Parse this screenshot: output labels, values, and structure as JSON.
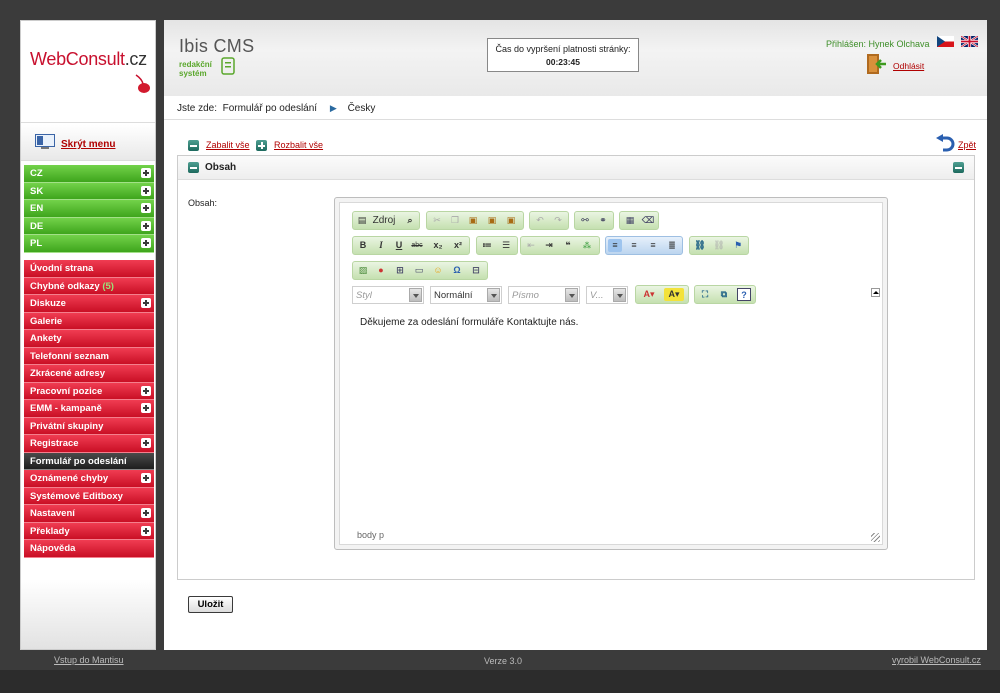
{
  "logo": {
    "text_red": "WebConsult",
    "text_dark": ".cz"
  },
  "sidebar": {
    "hide_menu_label": "Skrýt menu",
    "languages": [
      {
        "label": "CZ",
        "expandable": true
      },
      {
        "label": "SK",
        "expandable": true
      },
      {
        "label": "EN",
        "expandable": true
      },
      {
        "label": "DE",
        "expandable": true
      },
      {
        "label": "PL",
        "expandable": true
      }
    ],
    "items": [
      {
        "label": "Úvodní strana",
        "count": "",
        "expandable": false,
        "active": false
      },
      {
        "label": "Chybné odkazy",
        "count": "(5)",
        "expandable": false,
        "active": false
      },
      {
        "label": "Diskuze",
        "count": "",
        "expandable": true,
        "active": false
      },
      {
        "label": "Galerie",
        "count": "",
        "expandable": false,
        "active": false
      },
      {
        "label": "Ankety",
        "count": "",
        "expandable": false,
        "active": false
      },
      {
        "label": "Telefonní seznam",
        "count": "",
        "expandable": false,
        "active": false
      },
      {
        "label": "Zkrácené adresy",
        "count": "",
        "expandable": false,
        "active": false
      },
      {
        "label": "Pracovní pozice",
        "count": "",
        "expandable": true,
        "active": false
      },
      {
        "label": "EMM - kampaně",
        "count": "",
        "expandable": true,
        "active": false
      },
      {
        "label": "Privátní skupiny",
        "count": "",
        "expandable": false,
        "active": false
      },
      {
        "label": "Registrace",
        "count": "",
        "expandable": true,
        "active": false
      },
      {
        "label": "Formulář po odeslání",
        "count": "",
        "expandable": false,
        "active": true
      },
      {
        "label": "Oznámené chyby",
        "count": "",
        "expandable": true,
        "active": false
      },
      {
        "label": "Systémové Editboxy",
        "count": "",
        "expandable": false,
        "active": false
      },
      {
        "label": "Nastavení",
        "count": "",
        "expandable": true,
        "active": false
      },
      {
        "label": "Překlady",
        "count": "",
        "expandable": true,
        "active": false
      },
      {
        "label": "Nápověda",
        "count": "",
        "expandable": false,
        "active": false
      }
    ]
  },
  "header": {
    "cms_title": "Ibis CMS",
    "cms_sub_1": "redakční",
    "cms_sub_2": "systém",
    "timer_label": "Čas do vypršení platnosti stránky:",
    "timer_value": "00:23:45",
    "user_label": "Přihlášen: Hynek Olchava",
    "logout": "Odhlásit"
  },
  "breadcrumb": {
    "prefix": "Jste zde:",
    "page": "Formulář po odeslání",
    "lang": "Česky"
  },
  "actions": {
    "collapse_all": "Zabalit vše",
    "expand_all": "Rozbalit vše",
    "back": "Zpět"
  },
  "section": {
    "title": "Obsah",
    "field_label": "Obsah:"
  },
  "editor": {
    "source_label": "Zdroj",
    "combos": {
      "style": "Styl",
      "format": "Normální",
      "font": "Písmo",
      "size": "V..."
    },
    "content": "Děkujeme za odeslání formuláře Kontaktujte nás.",
    "path": "body  p"
  },
  "save_label": "Uložit",
  "footer": {
    "left": "Vstup do Mantisu",
    "middle": "Verze 3.0",
    "right": "vyrobil WebConsult.cz"
  },
  "colors": {
    "menu_green": "#4bb526",
    "menu_red": "#e0203a",
    "menu_active": "#2b2b2b",
    "link_red": "#b00000"
  }
}
